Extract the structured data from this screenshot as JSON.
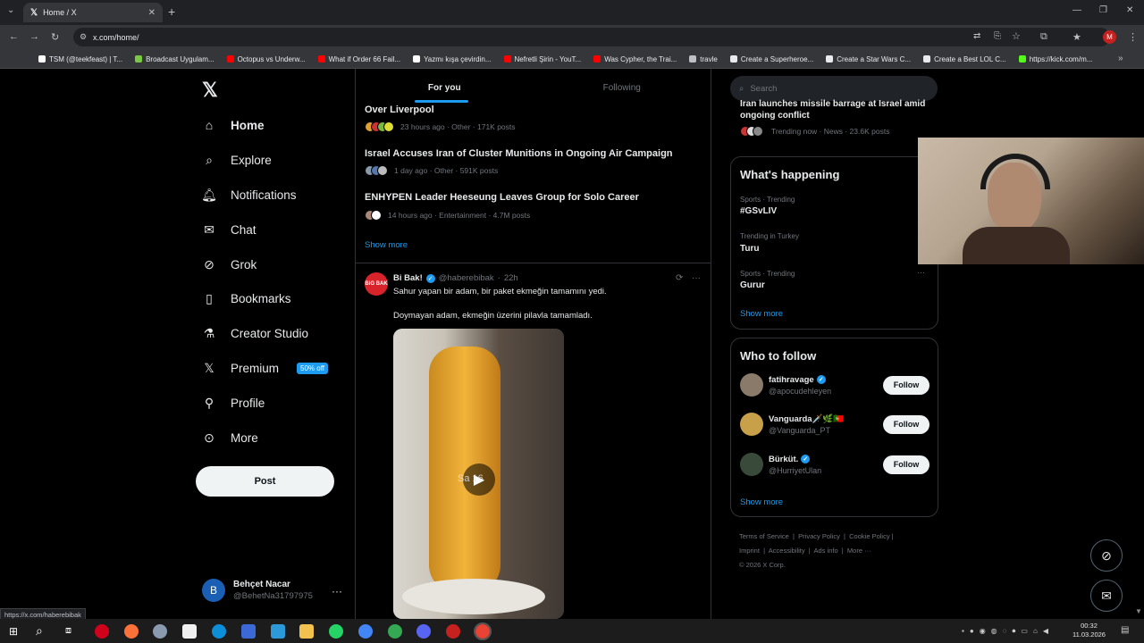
{
  "browser": {
    "tab_title": "Home / X",
    "url": "x.com/home/",
    "bookmarks": [
      {
        "label": "TSM (@teekfeast) | T...",
        "color": "#ffffff"
      },
      {
        "label": "Broadcast Uygulam...",
        "color": "#7ac943"
      },
      {
        "label": "Octopus vs Underw...",
        "color": "#ff0000"
      },
      {
        "label": "What if Order 66 Fail...",
        "color": "#ff0000"
      },
      {
        "label": "Yazmı kışa çevirdin...",
        "color": "#ffffff"
      },
      {
        "label": "Nefretli Şirin - YouT...",
        "color": "#ff0000"
      },
      {
        "label": "Was Cypher, the Trai...",
        "color": "#ff0000"
      },
      {
        "label": "travle",
        "color": "#bdc1c6"
      },
      {
        "label": "Create a Superheroe...",
        "color": "#e8eaed"
      },
      {
        "label": "Create a Star Wars C...",
        "color": "#e8eaed"
      },
      {
        "label": "Create a Best LOL C...",
        "color": "#e8eaed"
      },
      {
        "label": "https://kick.com/m...",
        "color": "#53fc18"
      }
    ],
    "status_url": "https://x.com/haberebibak",
    "profile_initial": "M"
  },
  "nav": {
    "items": [
      {
        "label": "Home",
        "icon": "home-icon"
      },
      {
        "label": "Explore",
        "icon": "search-icon"
      },
      {
        "label": "Notifications",
        "icon": "bell-icon"
      },
      {
        "label": "Chat",
        "icon": "mail-icon"
      },
      {
        "label": "Grok",
        "icon": "grok-icon"
      },
      {
        "label": "Bookmarks",
        "icon": "bookmark-icon"
      },
      {
        "label": "Creator Studio",
        "icon": "flask-icon"
      },
      {
        "label": "Premium",
        "icon": "x-icon"
      },
      {
        "label": "Profile",
        "icon": "person-icon"
      },
      {
        "label": "More",
        "icon": "more-circle-icon"
      }
    ],
    "premium_badge": "50% off",
    "post_label": "Post",
    "user": {
      "initial": "B",
      "name": "Behçet Nacar",
      "handle": "@BehetNa31797975"
    }
  },
  "feed": {
    "tabs": [
      "For you",
      "Following"
    ],
    "trends": [
      {
        "title": "Over Liverpool",
        "meta": "23 hours ago · Other · 171K posts"
      },
      {
        "title": "Israel Accuses Iran of Cluster Munitions in Ongoing Air Campaign",
        "meta": "1 day ago · Other · 591K posts"
      },
      {
        "title": "ENHYPEN Leader Heeseung Leaves Group for Solo Career",
        "meta": "14 hours ago · Entertainment · 4.7M posts"
      }
    ],
    "show_more": "Show more",
    "tweet": {
      "avatar_text": "BiG BAK",
      "name": "Bi Bak!",
      "handle": "@haberebibak",
      "time": "22h",
      "line1": "Sahur yapan bir adam, bir paket ekmeğin tamamını yedi.",
      "line2": "Doymayan adam, ekmeğin üzerini pilavla tamamladı.",
      "media_label": "Sa   16"
    }
  },
  "right": {
    "search_placeholder": "Search",
    "top_trend": {
      "title": "Iran launches missile barrage at Israel amid ongoing conflict",
      "meta": "Trending now · News · 23.6K posts"
    },
    "whats_happening": {
      "title": "What's happening",
      "items": [
        {
          "meta": "Sports · Trending",
          "tag": "#GSvLIV"
        },
        {
          "meta": "Trending in Turkey",
          "tag": "Turu"
        },
        {
          "meta": "Sports · Trending",
          "tag": "Gurur"
        }
      ],
      "show_more": "Show more"
    },
    "who_to_follow": {
      "title": "Who to follow",
      "users": [
        {
          "name": "fatihravage",
          "handle": "@apocudehleyen",
          "verified": true,
          "color": "#8a7a6a"
        },
        {
          "name": "Vanguarda🗡️🌿🇵🇹",
          "handle": "@Vanguarda_PT",
          "verified": false,
          "color": "#c8a04a"
        },
        {
          "name": "Bürküt.",
          "handle": "@HurriyetUlan",
          "verified": true,
          "color": "#3a4a3a"
        }
      ],
      "follow_label": "Follow",
      "show_more": "Show more"
    },
    "footer": [
      "Terms of Service",
      "Privacy Policy",
      "Cookie Policy",
      "Imprint",
      "Accessibility",
      "Ads info",
      "More ···",
      "© 2026 X Corp."
    ]
  },
  "taskbar": {
    "time": "00:32",
    "date": "11.03.2026"
  }
}
